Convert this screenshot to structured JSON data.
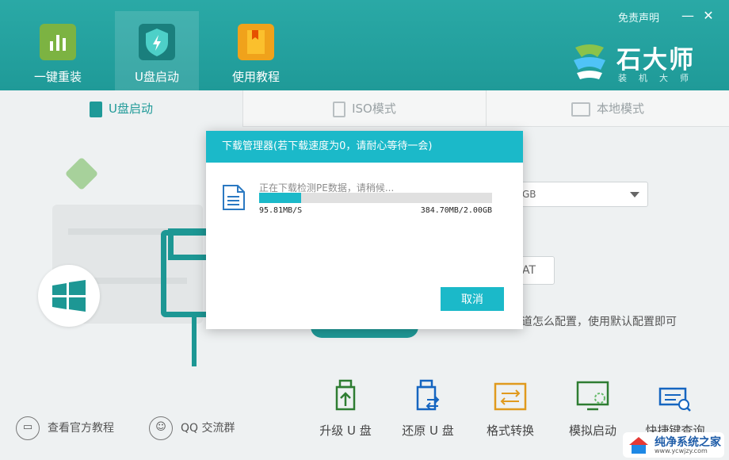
{
  "header": {
    "tabs": [
      {
        "label": "一键重装",
        "icon": "bar-chart-icon"
      },
      {
        "label": "U盘启动",
        "icon": "shield-bolt-icon"
      },
      {
        "label": "使用教程",
        "icon": "book-icon"
      }
    ],
    "disclaimer": "免责声明",
    "minimize": "—",
    "close": "✕",
    "logo_text": "石大师",
    "logo_sub": "装机大师"
  },
  "mode_tabs": [
    {
      "label": "U盘启动",
      "icon": "usb-drive-icon"
    },
    {
      "label": "ISO模式",
      "icon": "iso-file-icon"
    },
    {
      "label": "本地模式",
      "icon": "monitor-icon"
    }
  ],
  "main": {
    "select_value": "GB",
    "format_value": "AT",
    "hint": "道怎么配置，使用默认配置即可"
  },
  "bottom": {
    "left_links": [
      {
        "label": "查看官方教程",
        "icon": "book-icon"
      },
      {
        "label": "QQ 交流群",
        "icon": "users-icon"
      }
    ],
    "tools": [
      {
        "label": "升级 U 盘",
        "icon": "upgrade-usb-icon"
      },
      {
        "label": "还原 U 盘",
        "icon": "restore-usb-icon"
      },
      {
        "label": "格式转换",
        "icon": "format-convert-icon"
      },
      {
        "label": "模拟启动",
        "icon": "simulate-boot-icon"
      },
      {
        "label": "快捷键查询",
        "icon": "keyboard-search-icon"
      }
    ]
  },
  "modal": {
    "title": "下载管理器(若下载速度为0，请耐心等待一会)",
    "status": "正在下载检测PE数据，请稍候...",
    "speed": "95.81MB/S",
    "size": "384.70MB/2.00GB",
    "progress": 0.18,
    "cancel": "取消"
  },
  "watermark": {
    "main": "纯净系统之家",
    "sub": "www.ycwjzy.com"
  },
  "colors": {
    "accent": "#1bb9c9",
    "header": "#1f9a98"
  }
}
